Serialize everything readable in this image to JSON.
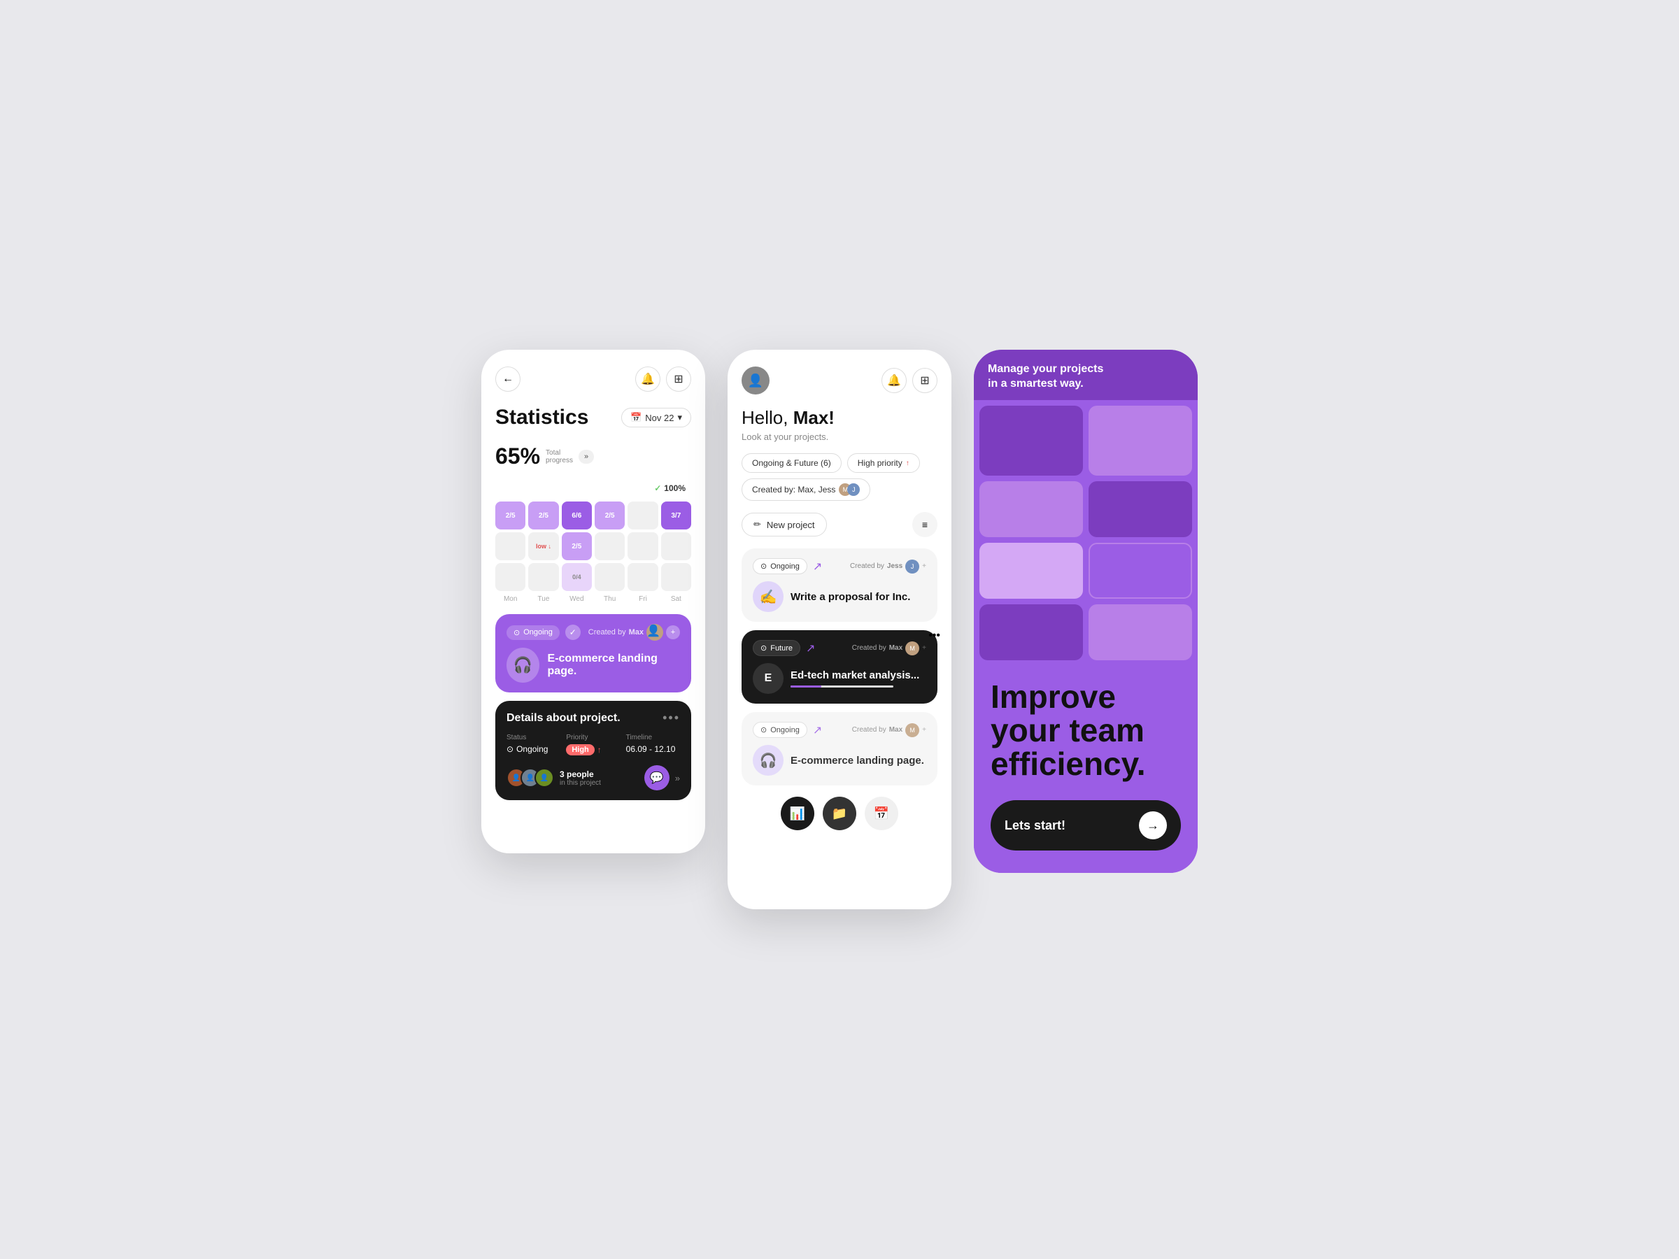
{
  "screen1": {
    "back_label": "←",
    "title": "Statistics",
    "date_label": "Nov 22",
    "progress_pct": "65%",
    "progress_text": "Total\nprogress",
    "progress_arr": "»",
    "chart_100_label": "100%",
    "chart_columns": [
      {
        "day": "Mon",
        "top": "2/5",
        "mid": "",
        "bot": "",
        "levels": [
          "light",
          "empty",
          "empty"
        ]
      },
      {
        "day": "Tue",
        "top": "2/5",
        "mid": "low",
        "bot": "",
        "levels": [
          "light",
          "label",
          "empty"
        ]
      },
      {
        "day": "Wed",
        "top": "6/6",
        "mid": "2/5",
        "bot": "0/4",
        "levels": [
          "dark",
          "light",
          "very-light"
        ]
      },
      {
        "day": "Thu",
        "top": "2/5",
        "mid": "",
        "bot": "",
        "levels": [
          "light",
          "empty",
          "empty"
        ]
      },
      {
        "day": "Fri",
        "top": "",
        "mid": "",
        "bot": "",
        "levels": [
          "empty",
          "empty",
          "empty"
        ]
      },
      {
        "day": "Sat",
        "top": "3/7",
        "mid": "",
        "bot": "",
        "levels": [
          "dark",
          "empty",
          "empty"
        ]
      }
    ],
    "card_purple": {
      "status": "Ongoing",
      "created_by": "Created by",
      "creator": "Max",
      "title": "E-commerce landing page."
    },
    "card_dark": {
      "title": "Details about project.",
      "status_label": "Status",
      "status_val": "Ongoing",
      "priority_label": "Priority",
      "priority_val": "High",
      "timeline_label": "Timeline",
      "timeline_val": "06.09 - 12.10",
      "people_count": "3 people",
      "people_sub": "in this project"
    }
  },
  "screen2": {
    "greeting": "Hello,",
    "name": "Max!",
    "subtitle": "Look at your projects.",
    "chips": [
      {
        "label": "Ongoing & Future (6)",
        "has_dot": false
      },
      {
        "label": "High priority",
        "has_dot": true
      },
      {
        "label": "Created by: Max, Jess",
        "has_avatar": true
      }
    ],
    "new_project_btn": "New project",
    "cards": [
      {
        "status": "Ongoing",
        "created_by": "Created by",
        "creator": "Jess",
        "title": "Write a proposal for Inc.",
        "dark": false,
        "avatar_letter": "✍"
      },
      {
        "status": "Future",
        "created_by": "Created by",
        "creator": "Max",
        "title": "Ed-tech market analysis...",
        "dark": true,
        "avatar_letter": "E"
      },
      {
        "status": "Ongoing",
        "created_by": "Created by",
        "creator": "Max",
        "title": "E-commerce landing page.",
        "dark": false,
        "avatar_letter": "🎧"
      }
    ],
    "nav": [
      "📊",
      "📁",
      "📅"
    ]
  },
  "screen3": {
    "banner_text": "Manage your projects\nin a smartest way.",
    "big_text": "Improve\nyour team\nefficiency.",
    "cta_label": "Lets start!",
    "cta_arrow": "→"
  }
}
